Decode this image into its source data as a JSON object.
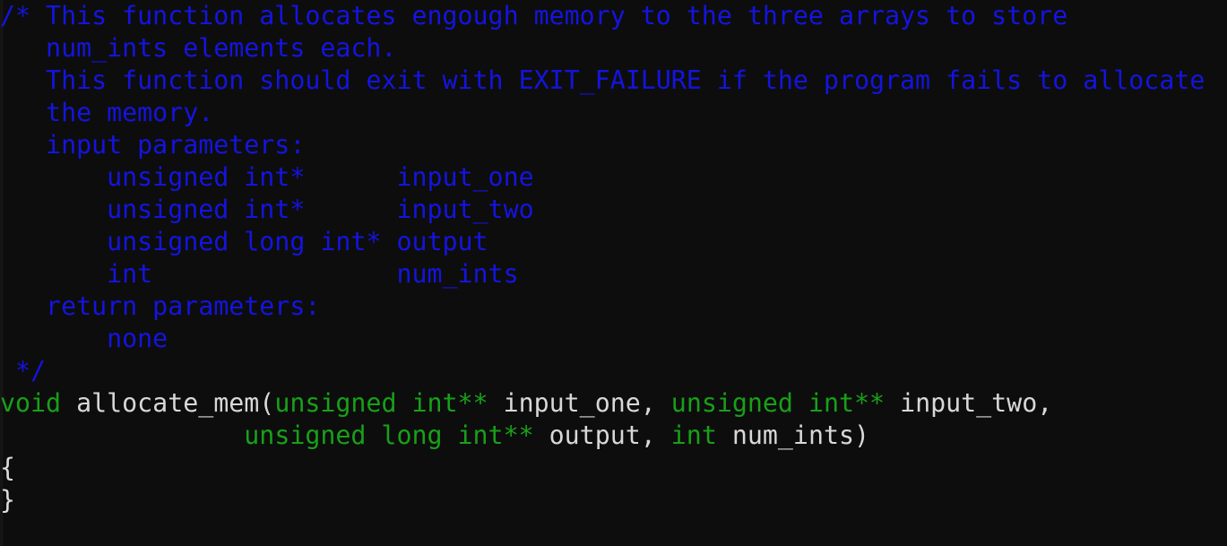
{
  "window": {
    "kind": "code-editor",
    "language": "C",
    "background_color": "#0d0d0d",
    "font_size_px": 27,
    "line_height_px": 36
  },
  "theme": {
    "background": "#0d0d0d",
    "comment_color": "#1414e0",
    "keyword_color": "#18a018",
    "plain_color": "#d8d8d8",
    "brace_color": "#dcdcdc"
  },
  "code": {
    "lines": [
      {
        "n": 1,
        "tokens": [
          {
            "t": "/* This function allocates engough memory to the three arrays to store",
            "c": "cmt"
          }
        ]
      },
      {
        "n": 2,
        "tokens": [
          {
            "t": "   num_ints elements each.",
            "c": "cmt"
          }
        ]
      },
      {
        "n": 3,
        "tokens": [
          {
            "t": "   This function should exit with EXIT_FAILURE if the program fails to allocate",
            "c": "cmt"
          }
        ]
      },
      {
        "n": 4,
        "tokens": [
          {
            "t": "   the memory.",
            "c": "cmt"
          }
        ]
      },
      {
        "n": 5,
        "tokens": [
          {
            "t": "   input parameters:",
            "c": "cmt"
          }
        ]
      },
      {
        "n": 6,
        "tokens": [
          {
            "t": "       unsigned int*      input_one",
            "c": "cmt"
          }
        ]
      },
      {
        "n": 7,
        "tokens": [
          {
            "t": "       unsigned int*      input_two",
            "c": "cmt"
          }
        ]
      },
      {
        "n": 8,
        "tokens": [
          {
            "t": "       unsigned long int* output",
            "c": "cmt"
          }
        ]
      },
      {
        "n": 9,
        "tokens": [
          {
            "t": "       int                num_ints",
            "c": "cmt"
          }
        ]
      },
      {
        "n": 10,
        "tokens": [
          {
            "t": "   return parameters:",
            "c": "cmt"
          }
        ]
      },
      {
        "n": 11,
        "tokens": [
          {
            "t": "       none",
            "c": "cmt"
          }
        ]
      },
      {
        "n": 12,
        "tokens": [
          {
            "t": " */",
            "c": "cmt"
          }
        ]
      },
      {
        "n": 13,
        "tokens": [
          {
            "t": "void",
            "c": "kw"
          },
          {
            "t": " allocate_mem(",
            "c": "pln"
          },
          {
            "t": "unsigned int**",
            "c": "kw"
          },
          {
            "t": " input_one, ",
            "c": "pln"
          },
          {
            "t": "unsigned int**",
            "c": "kw"
          },
          {
            "t": " input_two,",
            "c": "pln"
          }
        ]
      },
      {
        "n": 14,
        "tokens": [
          {
            "t": "                ",
            "c": "pln"
          },
          {
            "t": "unsigned long int**",
            "c": "kw"
          },
          {
            "t": " output, ",
            "c": "pln"
          },
          {
            "t": "int",
            "c": "kw"
          },
          {
            "t": " num_ints)",
            "c": "pln"
          }
        ]
      },
      {
        "n": 15,
        "tokens": [
          {
            "t": "{",
            "c": "brc"
          }
        ]
      },
      {
        "n": 16,
        "tokens": [
          {
            "t": "}",
            "c": "brc"
          }
        ]
      }
    ]
  }
}
